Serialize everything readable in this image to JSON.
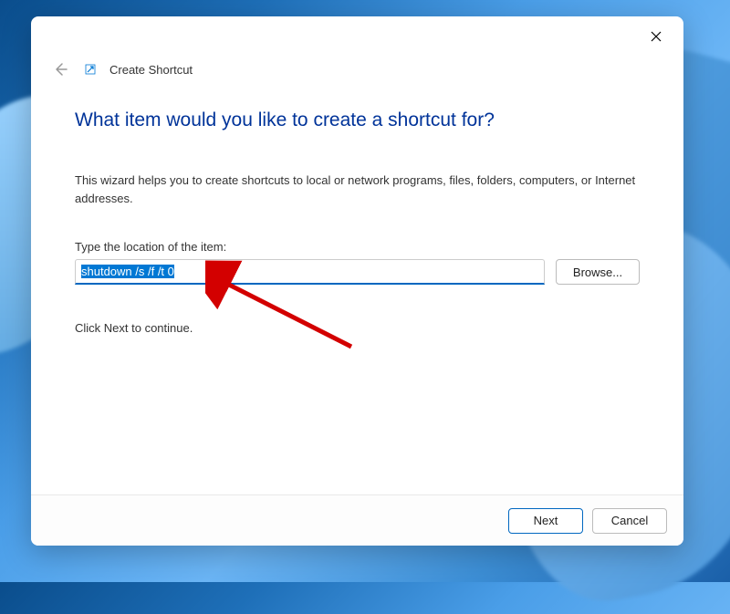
{
  "dialog": {
    "breadcrumb": "Create Shortcut",
    "heading": "What item would you like to create a shortcut for?",
    "description": "This wizard helps you to create shortcuts to local or network programs, files, folders, computers, or Internet addresses.",
    "field_label": "Type the location of the item:",
    "location_value": "shutdown /s /f /t 0",
    "browse_label": "Browse...",
    "continue_text": "Click Next to continue.",
    "next_label": "Next",
    "cancel_label": "Cancel"
  }
}
